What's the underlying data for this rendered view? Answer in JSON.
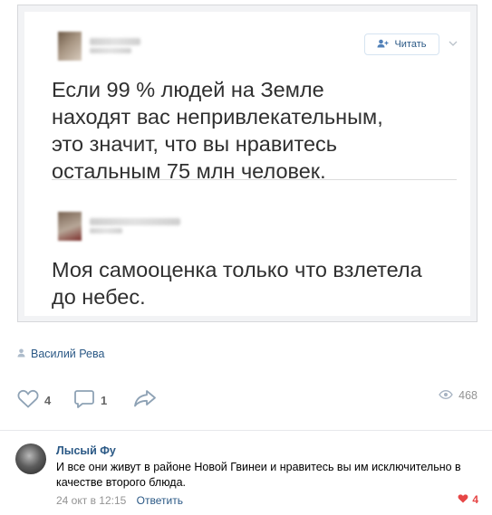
{
  "post": {
    "image": {
      "follow_label": "Читать",
      "tweet1_lines": [
        "Если 99 % людей на Земле",
        "находят вас непривлекательным,",
        "это значит, что вы нравитесь",
        "остальным 75 млн человек."
      ],
      "tweet2_lines": [
        "Моя самооценка только что взлетела",
        "до небес."
      ]
    },
    "author": "Василий Рева",
    "likes": "4",
    "comments": "1",
    "views": "468"
  },
  "comment": {
    "name": "Лысый Фу",
    "text": "И все они живут в районе Новой Гвинеи и нравитесь вы им исключительно в качестве второго блюда.",
    "date": "24 окт в 12:15",
    "reply_label": "Ответить",
    "likes": "4"
  },
  "colors": {
    "link": "#2a5885",
    "like_red": "#e64646",
    "muted": "#939393"
  },
  "icons": [
    "add-user-icon",
    "chevron-down-icon",
    "person-icon",
    "heart-icon",
    "comment-icon",
    "share-icon",
    "eye-icon"
  ]
}
